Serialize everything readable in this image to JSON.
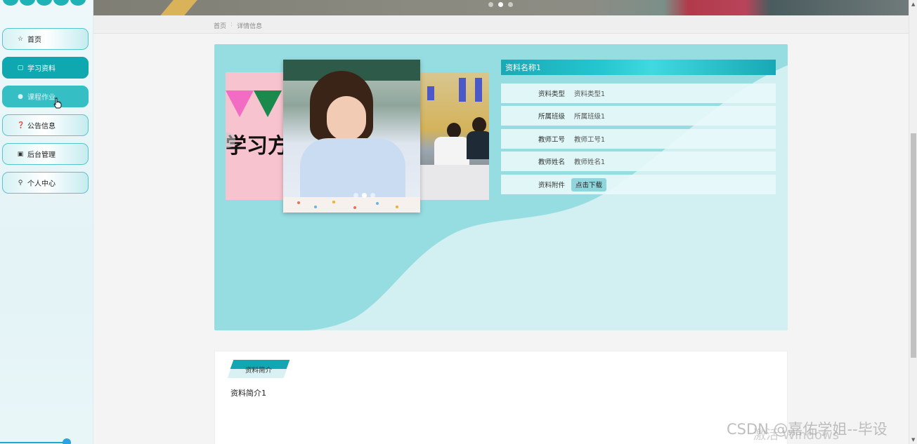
{
  "sidebar": {
    "items": [
      {
        "label": "首页",
        "icon": "star-icon",
        "state": "normal"
      },
      {
        "label": "学习资料",
        "icon": "bag-icon",
        "state": "active"
      },
      {
        "label": "课程作业",
        "icon": "circle-icon",
        "state": "hover"
      },
      {
        "label": "公告信息",
        "icon": "question-icon",
        "state": "normal"
      },
      {
        "label": "后台管理",
        "icon": "calendar-icon",
        "state": "normal"
      },
      {
        "label": "个人中心",
        "icon": "user-icon",
        "state": "normal"
      }
    ]
  },
  "breadcrumb": {
    "home": "首页",
    "separator": ":",
    "current": "详情信息"
  },
  "detail": {
    "title": "资料名称1",
    "promo_text": "学习方",
    "fields": [
      {
        "key": "资料类型",
        "value": "资料类型1"
      },
      {
        "key": "所属班级",
        "value": "所属班级1"
      },
      {
        "key": "教师工号",
        "value": "教师工号1"
      },
      {
        "key": "教师姓名",
        "value": "教师姓名1"
      }
    ],
    "attachment": {
      "key": "资料附件",
      "button": "点击下载"
    }
  },
  "intro": {
    "tab_label": "资料简介",
    "content": "资料简介1"
  },
  "overlay": {
    "watermark": "CSDN @嘉佑学姐--毕设",
    "activate": "激活 Windows"
  },
  "colors": {
    "primary": "#0fa7b0",
    "card_bg": "#96dde2",
    "sidebar_bg": "#e9f6f8"
  }
}
